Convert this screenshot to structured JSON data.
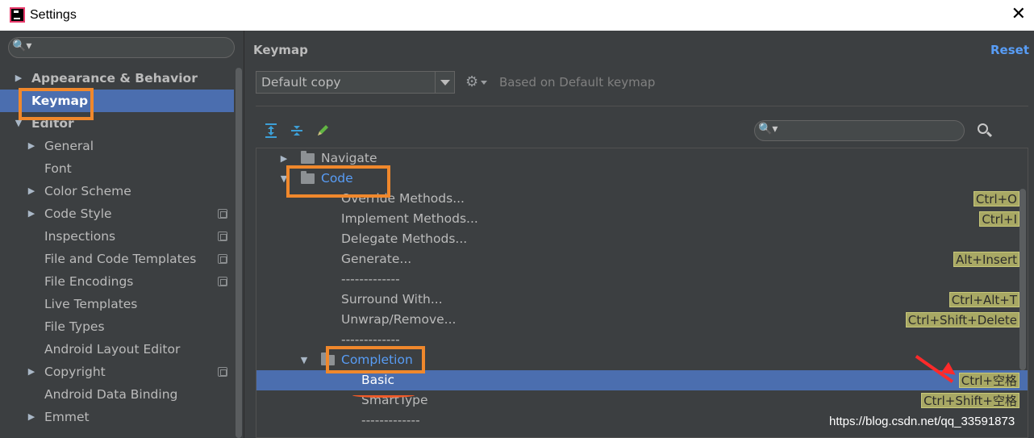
{
  "window": {
    "title": "Settings",
    "close_glyph": "✕"
  },
  "left_tree": {
    "search_icon": "search-icon",
    "items": [
      {
        "label": "Appearance & Behavior",
        "arrow": "▶"
      },
      {
        "label": "Keymap",
        "arrow": ""
      },
      {
        "label": "Editor",
        "arrow": "▼"
      },
      {
        "label": "General",
        "arrow": "▶"
      },
      {
        "label": "Font",
        "arrow": ""
      },
      {
        "label": "Color Scheme",
        "arrow": "▶"
      },
      {
        "label": "Code Style",
        "arrow": "▶"
      },
      {
        "label": "Inspections",
        "arrow": ""
      },
      {
        "label": "File and Code Templates",
        "arrow": ""
      },
      {
        "label": "File Encodings",
        "arrow": ""
      },
      {
        "label": "Live Templates",
        "arrow": ""
      },
      {
        "label": "File Types",
        "arrow": ""
      },
      {
        "label": "Android Layout Editor",
        "arrow": ""
      },
      {
        "label": "Copyright",
        "arrow": "▶"
      },
      {
        "label": "Android Data Binding",
        "arrow": ""
      },
      {
        "label": "Emmet",
        "arrow": "▶"
      }
    ]
  },
  "keymap": {
    "title": "Keymap",
    "reset_label": "Reset",
    "scheme_value": "Default copy",
    "based_on": "Based on Default keymap",
    "actions": [
      {
        "label": "Navigate",
        "arrow": "▶",
        "shortcut": ""
      },
      {
        "label": "Code",
        "arrow": "▼",
        "shortcut": ""
      },
      {
        "label": "Override Methods...",
        "shortcut": "Ctrl+O"
      },
      {
        "label": "Implement Methods...",
        "shortcut": "Ctrl+I"
      },
      {
        "label": "Delegate Methods...",
        "shortcut": ""
      },
      {
        "label": "Generate...",
        "shortcut": "Alt+Insert"
      },
      {
        "label": "-------------",
        "shortcut": ""
      },
      {
        "label": "Surround With...",
        "shortcut": "Ctrl+Alt+T"
      },
      {
        "label": "Unwrap/Remove...",
        "shortcut": "Ctrl+Shift+Delete"
      },
      {
        "label": "-------------",
        "shortcut": ""
      },
      {
        "label": "Completion",
        "arrow": "▼",
        "shortcut": ""
      },
      {
        "label": "Basic",
        "shortcut": "Ctrl+空格"
      },
      {
        "label": "SmartType",
        "shortcut": "Ctrl+Shift+空格"
      },
      {
        "label": "-------------",
        "shortcut": ""
      }
    ]
  },
  "watermark": "https://blog.csdn.net/qq_33591873",
  "colors": {
    "accent": "#589df6",
    "selection": "#4b6eaf",
    "highlight": "#f0882c",
    "shortcut_bg": "#a8a864"
  }
}
